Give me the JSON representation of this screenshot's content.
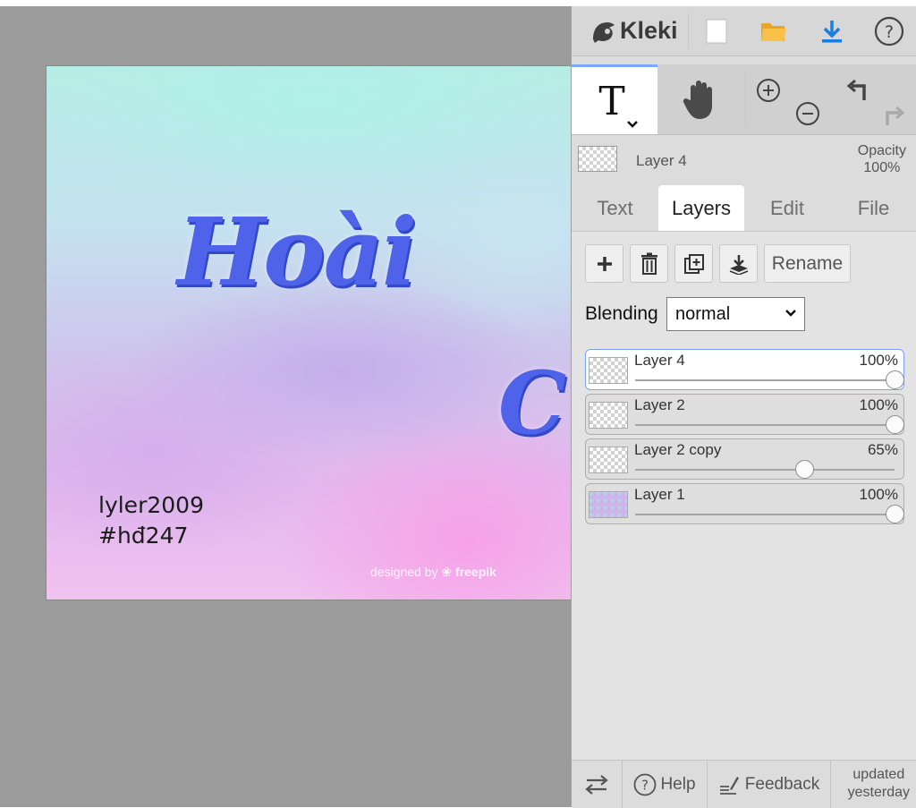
{
  "app": {
    "name": "Kleki"
  },
  "canvas": {
    "art_text_main": "Hoài",
    "art_text_second": "C",
    "credit_line1": "lyler2009",
    "credit_line2": "#hđ247",
    "watermark_prefix": "designed by",
    "watermark_brand": "freepik"
  },
  "current_layer": {
    "name": "Layer 4",
    "opacity_label": "Opacity",
    "opacity_value": "100%"
  },
  "tabs": [
    "Text",
    "Layers",
    "Edit",
    "File"
  ],
  "active_tab": "Layers",
  "layer_actions": {
    "rename_label": "Rename"
  },
  "blending": {
    "label": "Blending",
    "value": "normal"
  },
  "layers": [
    {
      "name": "Layer 4",
      "opacity": "100%",
      "opacity_fraction": 1.0,
      "selected": true
    },
    {
      "name": "Layer 2",
      "opacity": "100%",
      "opacity_fraction": 1.0,
      "selected": false
    },
    {
      "name": "Layer 2 copy",
      "opacity": "65%",
      "opacity_fraction": 0.65,
      "selected": false
    },
    {
      "name": "Layer 1",
      "opacity": "100%",
      "opacity_fraction": 1.0,
      "selected": false
    }
  ],
  "footer": {
    "help_label": "Help",
    "feedback_label": "Feedback",
    "updated_line1": "updated",
    "updated_line2": "yesterday"
  },
  "icons": {
    "logo": "kleki-logo-icon",
    "new": "new-image-icon",
    "open": "folder-icon",
    "download": "download-icon",
    "help": "help-icon",
    "text_tool": "text-tool-icon",
    "hand_tool": "hand-icon",
    "zoom_in": "zoom-in-icon",
    "zoom_out": "zoom-out-icon",
    "undo": "undo-icon",
    "redo": "redo-icon",
    "swap": "swap-sides-icon"
  },
  "colors": {
    "accent": "#7aa1f5",
    "download_blue": "#1a7de0",
    "folder_yellow": "#f6b93b",
    "art_blue": "#4f63ea"
  }
}
